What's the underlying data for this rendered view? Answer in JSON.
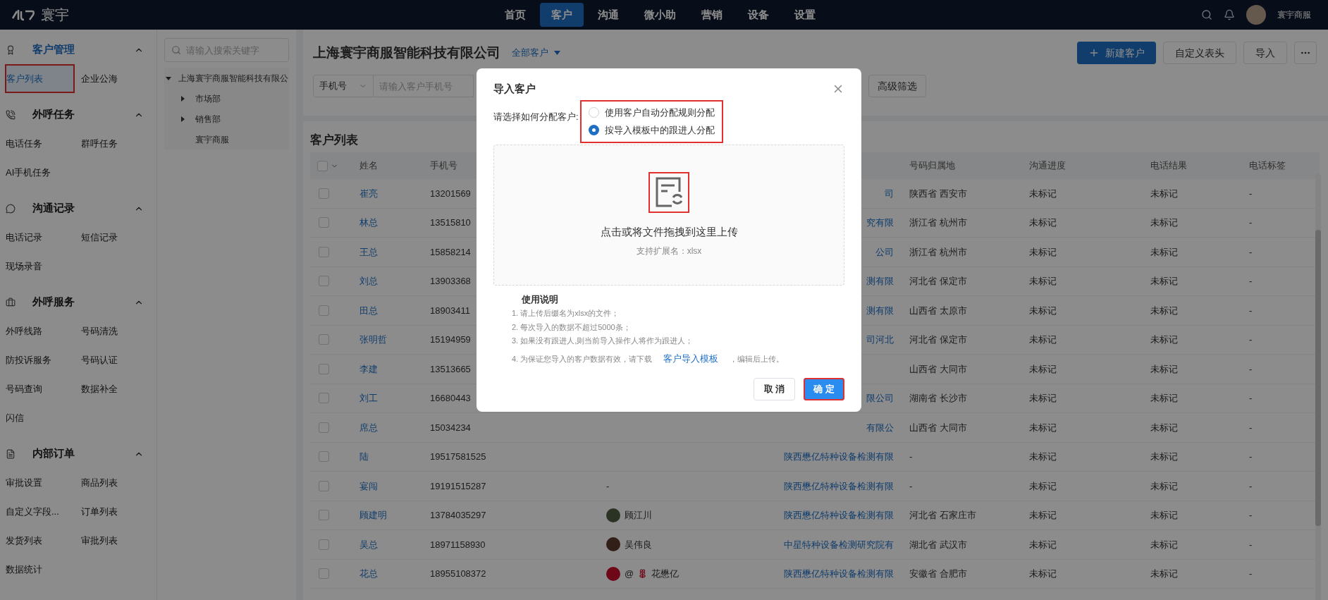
{
  "topbar": {
    "logo": "寰宇",
    "nav": [
      {
        "label": "首页",
        "selected": false
      },
      {
        "label": "客户",
        "selected": true
      },
      {
        "label": "沟通",
        "selected": false
      },
      {
        "label": "微小助",
        "selected": false
      },
      {
        "label": "营销",
        "selected": false
      },
      {
        "label": "设备",
        "selected": false
      },
      {
        "label": "设置",
        "selected": false
      }
    ],
    "user": "寰宇商服"
  },
  "sidebar": {
    "groups": [
      {
        "title": "客户管理",
        "expanded": true,
        "active": true,
        "items": [
          {
            "label": "客户列表",
            "selected": true,
            "annotated": true
          },
          {
            "label": "企业公海",
            "selected": false,
            "annotated": false
          }
        ]
      },
      {
        "title": "外呼任务",
        "expanded": true,
        "active": false,
        "items": [
          {
            "label": "电话任务",
            "selected": false,
            "annotated": false
          },
          {
            "label": "群呼任务",
            "selected": false,
            "annotated": false
          },
          {
            "label": "AI手机任务",
            "selected": false,
            "annotated": false
          }
        ]
      },
      {
        "title": "沟通记录",
        "expanded": true,
        "active": false,
        "items": [
          {
            "label": "电话记录",
            "selected": false,
            "annotated": false
          },
          {
            "label": "短信记录",
            "selected": false,
            "annotated": false
          },
          {
            "label": "现场录音",
            "selected": false,
            "annotated": false
          }
        ]
      },
      {
        "title": "外呼服务",
        "expanded": true,
        "active": false,
        "items": [
          {
            "label": "外呼线路",
            "selected": false,
            "annotated": false
          },
          {
            "label": "号码清洗",
            "selected": false,
            "annotated": false
          },
          {
            "label": "防投诉服务",
            "selected": false,
            "annotated": false
          },
          {
            "label": "号码认证",
            "selected": false,
            "annotated": false
          },
          {
            "label": "号码查询",
            "selected": false,
            "annotated": false
          },
          {
            "label": "数据补全",
            "selected": false,
            "annotated": false
          },
          {
            "label": "闪信",
            "selected": false,
            "annotated": false
          }
        ]
      },
      {
        "title": "内部订单",
        "expanded": true,
        "active": false,
        "items": [
          {
            "label": "审批设置",
            "selected": false,
            "annotated": false
          },
          {
            "label": "商品列表",
            "selected": false,
            "annotated": false
          },
          {
            "label": "自定义字段...",
            "selected": false,
            "annotated": false
          },
          {
            "label": "订单列表",
            "selected": false,
            "annotated": false
          },
          {
            "label": "发货列表",
            "selected": false,
            "annotated": false
          },
          {
            "label": "审批列表",
            "selected": false,
            "annotated": false
          },
          {
            "label": "数据统计",
            "selected": false,
            "annotated": false
          }
        ]
      }
    ]
  },
  "tree": {
    "search_placeholder": "请输入搜索关键字",
    "nodes": [
      {
        "label": "上海寰宇商服智能科技有限公",
        "expandable": true,
        "expanded": true,
        "children": [
          {
            "label": "市场部",
            "expandable": true,
            "expanded": false
          },
          {
            "label": "销售部",
            "expandable": true,
            "expanded": false
          },
          {
            "label": "寰宇商服",
            "expandable": false
          }
        ]
      }
    ]
  },
  "main": {
    "company_title": "上海寰宇商服智能科技有限公司",
    "scope": "全部客户",
    "actions": [
      {
        "kind": "primary",
        "label": "新建客户"
      },
      {
        "kind": "default",
        "label": "自定义表头"
      },
      {
        "kind": "default",
        "label": "导入"
      },
      {
        "kind": "more"
      }
    ],
    "filters": {
      "field": "手机号",
      "placeholder": "请输入客户手机号",
      "advanced": "高级筛选"
    }
  },
  "table": {
    "title": "客户列表",
    "select_all_checked": false,
    "headers": {
      "name": "姓名",
      "phone": "手机号",
      "location": "号码归属地",
      "progress": "沟通进度",
      "result": "电话结果",
      "tag": "电话标签"
    },
    "rows": [
      {
        "checked": false,
        "name": "崔亮",
        "phone": "13201569",
        "company": "司",
        "location": "陕西省 西安市",
        "progress": "未标记",
        "result": "未标记",
        "tag": "-"
      },
      {
        "checked": false,
        "name": "林总",
        "phone": "13515810",
        "company": "究有限",
        "location": "浙江省 杭州市",
        "progress": "未标记",
        "result": "未标记",
        "tag": "-"
      },
      {
        "checked": false,
        "name": "王总",
        "phone": "15858214",
        "company": "公司",
        "location": "浙江省 杭州市",
        "progress": "未标记",
        "result": "未标记",
        "tag": "-"
      },
      {
        "checked": false,
        "name": "刘总",
        "phone": "13903368",
        "company": "测有限",
        "location": "河北省 保定市",
        "progress": "未标记",
        "result": "未标记",
        "tag": "-"
      },
      {
        "checked": false,
        "name": "田总",
        "phone": "18903411",
        "company": "测有限",
        "location": "山西省 太原市",
        "progress": "未标记",
        "result": "未标记",
        "tag": "-"
      },
      {
        "checked": false,
        "name": "张明哲",
        "phone": "15194959",
        "company": "司河北",
        "location": "河北省 保定市",
        "progress": "未标记",
        "result": "未标记",
        "tag": "-"
      },
      {
        "checked": false,
        "name": "李建",
        "phone": "13513665",
        "location": "山西省 大同市",
        "progress": "未标记",
        "result": "未标记",
        "tag": "-"
      },
      {
        "checked": false,
        "name": "刘工",
        "phone": "16680443",
        "company": "限公司",
        "location": "湖南省 长沙市",
        "progress": "未标记",
        "result": "未标记",
        "tag": "-"
      },
      {
        "checked": false,
        "name": "席总",
        "phone": "15034234",
        "company": "有限公",
        "location": "山西省 大同市",
        "progress": "未标记",
        "result": "未标记",
        "tag": "-"
      },
      {
        "checked": false,
        "name": "陆",
        "phone": "19517581525",
        "company": "陕西懋亿特种设备检测有限",
        "location": "-",
        "progress": "未标记",
        "result": "未标记",
        "tag": "-"
      },
      {
        "checked": false,
        "name": "宴闯",
        "phone": "19191515287",
        "follower": {
          "name": "-",
          "avatar": false
        },
        "company": "陕西懋亿特种设备检测有限",
        "location": "-",
        "progress": "未标记",
        "result": "未标记",
        "tag": "-"
      },
      {
        "checked": false,
        "name": "顾建明",
        "phone": "13784035297",
        "follower": {
          "name": "顾江川",
          "avatar": true
        },
        "company": "陕西懋亿特种设备检测有限",
        "location": "河北省 石家庄市",
        "progress": "未标记",
        "result": "未标记",
        "tag": "-"
      },
      {
        "checked": false,
        "name": "吴总",
        "phone": "18971158930",
        "follower": {
          "name": "吴伟良",
          "avatar": true
        },
        "company": "中星特种设备检测研究院有",
        "location": "湖北省 武汉市",
        "progress": "未标记",
        "result": "未标记",
        "tag": "-"
      },
      {
        "checked": false,
        "name": "花总",
        "phone": "18955108372",
        "follower": {
          "prefix": "@",
          "name": "花懋亿",
          "avatar": true
        },
        "company": "陕西懋亿特种设备检测有限",
        "location": "安徽省 合肥市",
        "progress": "未标记",
        "result": "未标记",
        "tag": "-"
      }
    ]
  },
  "dialog": {
    "title": "导入客户",
    "assign_label": "请选择如何分配客户:",
    "options_annotated": true,
    "options": [
      {
        "label": "使用客户自动分配规则分配",
        "selected": false
      },
      {
        "label": "按导入模板中的跟进人分配",
        "selected": true
      }
    ],
    "upload": {
      "icon_annotated": true,
      "hint": "点击或将文件拖拽到这里上传",
      "extensions": "支持扩展名：xlsx"
    },
    "instructions": {
      "title": "使用说明",
      "items": [
        {
          "text": "1. 请上传后缀名为xlsx的文件；"
        },
        {
          "text": "2. 每次导入的数据不超过5000条；"
        },
        {
          "text": "3. 如果没有跟进人,则当前导入操作人将作为跟进人；"
        },
        {
          "text": "4. 为保证您导入的客户数据有效，请下载",
          "link": "客户导入模板",
          "after": "，编辑后上传。"
        }
      ]
    },
    "buttons": [
      {
        "kind": "default",
        "label": "取 消",
        "annotated": false
      },
      {
        "kind": "primary",
        "label": "确 定",
        "annotated": true
      }
    ]
  }
}
